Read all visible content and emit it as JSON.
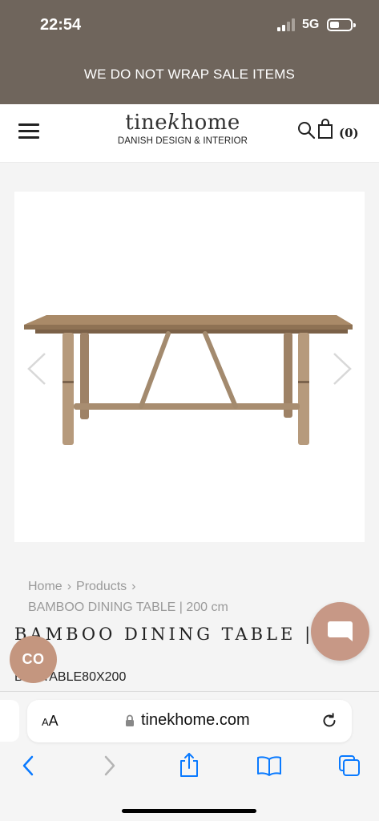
{
  "status_bar": {
    "time": "22:54",
    "network": "5G",
    "battery_level": 0.45
  },
  "promo": {
    "text": "WE DO NOT WRAP SALE ITEMS"
  },
  "header": {
    "logo_prefix": "tine",
    "logo_italic": "k",
    "logo_suffix": "home",
    "tagline": "DANISH DESIGN & INTERIOR",
    "cart_count": "(0)"
  },
  "breadcrumb": {
    "home": "Home",
    "products": "Products",
    "separator": "›",
    "current": "BAMBOO DINING TABLE | 200 cm"
  },
  "product": {
    "title": "BAMBOO DINING TABLE  |",
    "sku": "BAMTABLE80X200"
  },
  "chat": {
    "co_label": "CO"
  },
  "browser": {
    "aa_label_small": "A",
    "aa_label_large": "A",
    "url": "tinekhome.com"
  },
  "colors": {
    "brand_brown": "#6f655c",
    "chat_accent": "#c79886",
    "ios_blue": "#0a7aff"
  },
  "icons": [
    "menu-icon",
    "search-icon",
    "bag-icon",
    "chevron-left-icon",
    "chevron-right-icon",
    "chat-icon",
    "lock-icon",
    "reload-icon",
    "back-icon",
    "forward-icon",
    "share-icon",
    "bookmarks-icon",
    "tabs-icon"
  ]
}
